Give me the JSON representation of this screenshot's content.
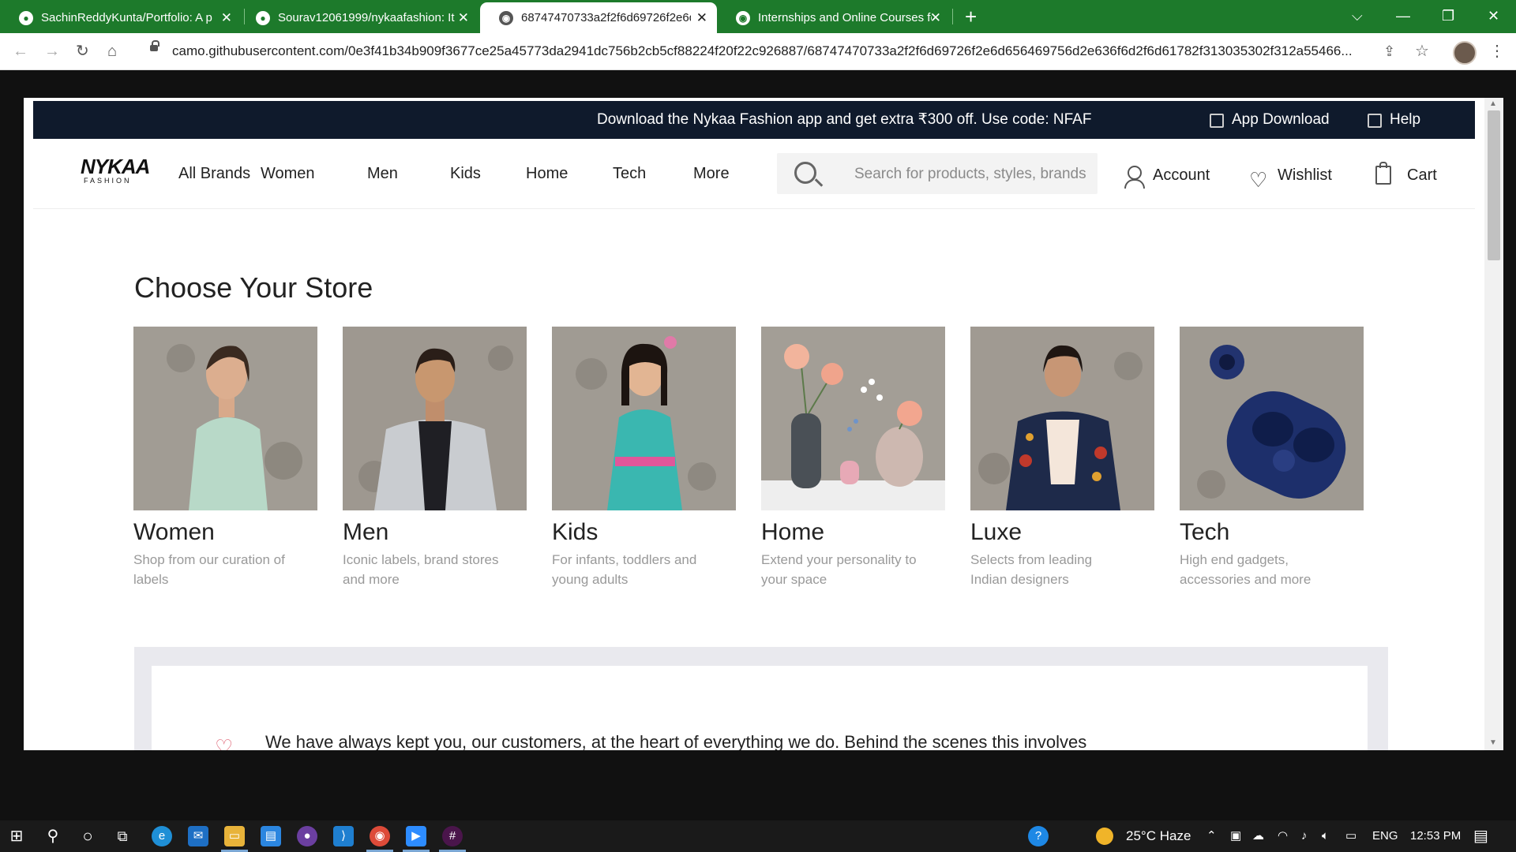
{
  "browser": {
    "tabs": [
      {
        "title": "SachinReddyKunta/Portfolio: A p",
        "icon": "github-icon",
        "active": false
      },
      {
        "title": "Sourav12061999/nykaafashion: It",
        "icon": "github-icon",
        "active": false
      },
      {
        "title": "68747470733a2f2f6d69726f2e6d",
        "icon": "globe-icon",
        "active": true
      },
      {
        "title": "Internships and Online Courses fo",
        "icon": "globe-icon",
        "active": false
      }
    ],
    "new_tab_label": "+",
    "url": "camo.githubusercontent.com/0e3f41b34b909f3677ce25a45773da2941dc756b2cb5cf88224f20f22c926887/68747470733a2f2f6d69726f2e6d656469756d2e636f6d2f6d61782f313035302f312a55466..."
  },
  "site": {
    "promo": {
      "text": "Download the Nykaa Fashion app and get extra ₹300 off. Use code: NFAF",
      "app_download": "App Download",
      "help": "Help"
    },
    "logo": {
      "main": "NYKAA",
      "sub": "FASHION"
    },
    "nav": [
      "All Brands",
      "Women",
      "Men",
      "Kids",
      "Home",
      "Tech",
      "More"
    ],
    "search": {
      "placeholder": "Search for products, styles, brands"
    },
    "actions": {
      "account": "Account",
      "wishlist": "Wishlist",
      "cart": "Cart"
    },
    "section_title": "Choose Your Store",
    "stores": [
      {
        "name": "Women",
        "desc": "Shop from our curation of labels"
      },
      {
        "name": "Men",
        "desc": "Iconic labels, brand stores and more"
      },
      {
        "name": "Kids",
        "desc": "For infants, toddlers and young adults"
      },
      {
        "name": "Home",
        "desc": "Extend your personality to your space"
      },
      {
        "name": "Luxe",
        "desc": "Selects from leading Indian designers"
      },
      {
        "name": "Tech",
        "desc": "High end gadgets, accessories and more"
      }
    ],
    "promise_text": "We have always kept you, our customers, at the heart of everything we do. Behind the scenes this involves"
  },
  "taskbar": {
    "weather": "25°C  Haze",
    "language": "ENG",
    "time": "12:53 PM"
  },
  "colors": {
    "tabbar": "#1d7a2b",
    "promo_bg": "#0f1a2c",
    "accent_heart": "#e06a7a"
  }
}
